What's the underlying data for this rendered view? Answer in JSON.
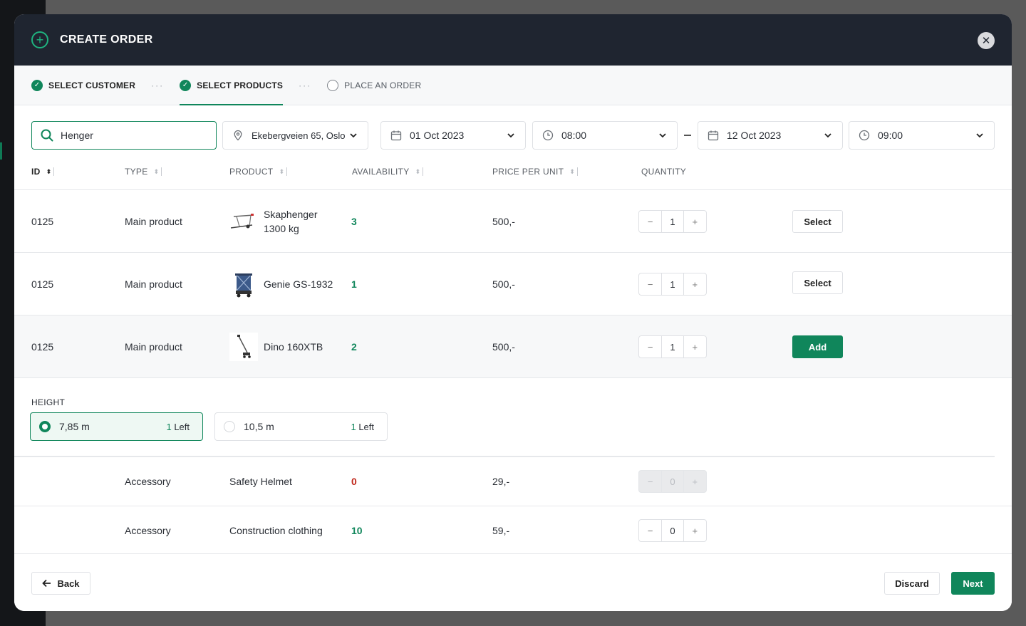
{
  "header": {
    "title": "CREATE ORDER"
  },
  "steps": [
    {
      "label": "SELECT CUSTOMER",
      "state": "done"
    },
    {
      "label": "SELECT PRODUCTS",
      "state": "active"
    },
    {
      "label": "PLACE AN ORDER",
      "state": "pending"
    }
  ],
  "step_separator": "···",
  "filters": {
    "search_value": "Henger",
    "location": "Ekebergveien 65, Oslo",
    "start_date": "01 Oct 2023",
    "start_time": "08:00",
    "end_date": "12 Oct 2023",
    "end_time": "09:00"
  },
  "table": {
    "columns": [
      "ID",
      "TYPE",
      "PRODUCT",
      "AVAILABILITY",
      "PRICE PER UNIT",
      "QUANTITY"
    ],
    "rows": [
      {
        "id": "0125",
        "type": "Main product",
        "product": "Skaphenger 1300 kg",
        "product_line1": "Skaphenger",
        "product_line2": "1300 kg",
        "availability": "3",
        "price": "500,-",
        "quantity": "1",
        "action": "Select"
      },
      {
        "id": "0125",
        "type": "Main product",
        "product": "Genie GS-1932",
        "availability": "1",
        "price": "500,-",
        "quantity": "1",
        "action": "Select"
      },
      {
        "id": "0125",
        "type": "Main product",
        "product": "Dino 160XTB",
        "availability": "2",
        "price": "500,-",
        "quantity": "1",
        "action": "Add"
      }
    ]
  },
  "height": {
    "label": "HEIGHT",
    "options": [
      {
        "value": "7,85 m",
        "left_count": "1",
        "left_label": "Left",
        "selected": true
      },
      {
        "value": "10,5 m",
        "left_count": "1",
        "left_label": "Left",
        "selected": false
      }
    ]
  },
  "accessories": [
    {
      "type": "Accessory",
      "product": "Safety Helmet",
      "availability": "0",
      "price": "29,-",
      "quantity": "0",
      "disabled": true
    },
    {
      "type": "Accessory",
      "product": "Construction clothing",
      "availability": "10",
      "price": "59,-",
      "quantity": "0",
      "disabled": false
    }
  ],
  "stepper_symbols": {
    "minus": "−",
    "plus": "+"
  },
  "footer": {
    "back": "Back",
    "discard": "Discard",
    "next": "Next"
  },
  "colors": {
    "accent": "#10865b",
    "header_bg": "#1f2530",
    "danger": "#c0261a"
  }
}
